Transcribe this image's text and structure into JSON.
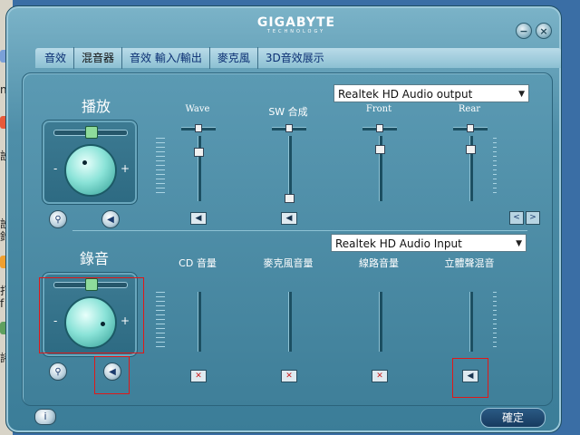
{
  "window": {
    "brand": "GIGABYTE",
    "brand_sub": "TECHNOLOGY",
    "minimize_glyph": "−",
    "close_glyph": "×"
  },
  "tabs": [
    {
      "label": "音效"
    },
    {
      "label": "混音器"
    },
    {
      "label": "音效 輸入/輸出"
    },
    {
      "label": "麥克風"
    },
    {
      "label": "3D音效展示"
    }
  ],
  "active_tab": "混音器",
  "playback": {
    "title": "播放",
    "device": "Realtek HD Audio output",
    "channels": [
      {
        "label": "Wave",
        "level": 0.8,
        "muted": false
      },
      {
        "label": "SW 合成",
        "level": 0.0,
        "muted": false
      },
      {
        "label": "Front",
        "level": 0.85,
        "muted": false
      },
      {
        "label": "Rear",
        "level": 0.85,
        "muted": false
      }
    ],
    "knob_minus": "-",
    "knob_plus": "+"
  },
  "recording": {
    "title": "錄音",
    "device": "Realtek HD Audio Input",
    "channels": [
      {
        "label": "CD 音量",
        "muted": true
      },
      {
        "label": "麥克風音量",
        "muted": true
      },
      {
        "label": "線路音量",
        "muted": true
      },
      {
        "label": "立體聲混音",
        "muted": false
      }
    ],
    "knob_minus": "-",
    "knob_plus": "+"
  },
  "buttons": {
    "ok": "確定",
    "info": "i",
    "prev": "<",
    "next": ">"
  },
  "icons": {
    "speaker": "speaker-icon",
    "settings": "wrench-icon",
    "info": "info-icon"
  },
  "desktop_glyphs": [
    "n",
    "設",
    "設",
    "鈴",
    "打",
    "f",
    "諸"
  ],
  "colors": {
    "accent": "#3b7d98",
    "highlight": "#e01818",
    "knob": "#8be3d8"
  }
}
